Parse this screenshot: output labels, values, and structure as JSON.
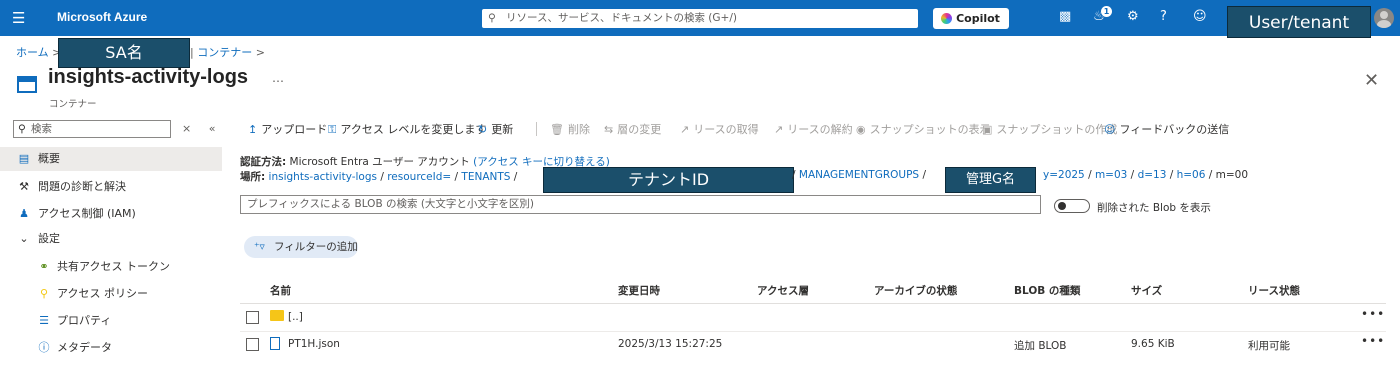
{
  "topbar": {
    "brand": "Microsoft Azure",
    "search_placeholder": "リソース、サービス、ドキュメントの検索 (G+/)",
    "copilot_label": "Copilot",
    "notification_count": "1",
    "redacted_user_label": "User/tenant"
  },
  "breadcrumb": {
    "home": "ホーム",
    "redacted_account": "SA名",
    "containers": "コンテナー"
  },
  "header": {
    "title": "insights-activity-logs",
    "subtitle": "コンテナー",
    "more": "…"
  },
  "sidebar": {
    "search_placeholder": "検索",
    "items": [
      {
        "label": "概要",
        "icon": "overview-icon"
      },
      {
        "label": "問題の診断と解決",
        "icon": "wrench-icon"
      },
      {
        "label": "アクセス制御 (IAM)",
        "icon": "people-icon"
      },
      {
        "label": "設定",
        "icon": "chevron-down-icon"
      },
      {
        "label": "共有アクセス トークン",
        "icon": "link-icon"
      },
      {
        "label": "アクセス ポリシー",
        "icon": "key-icon"
      },
      {
        "label": "プロパティ",
        "icon": "properties-icon"
      },
      {
        "label": "メタデータ",
        "icon": "info-icon"
      }
    ]
  },
  "toolbar": {
    "upload": "アップロード",
    "change_access": "アクセス レベルを変更します",
    "refresh": "更新",
    "delete": "削除",
    "change_tier": "層の変更",
    "acquire_lease": "リースの取得",
    "break_lease": "リースの解約",
    "view_snapshots": "スナップショットの表示",
    "create_snapshot": "スナップショットの作成",
    "feedback": "フィードバックの送信"
  },
  "info": {
    "auth_label": "認証方法:",
    "auth_value": "Microsoft Entra ユーザー アカウント",
    "auth_switch": "(アクセス キーに切り替える)",
    "location_label": "場所:",
    "path_1": "insights-activity-logs",
    "path_2": "resourceId=",
    "path_3": "TENANTS",
    "redacted_tenant": "テナントID",
    "path_4": "MANAGEMENTGROUPS",
    "redacted_mg": "管理G名",
    "path_5": "y=2025",
    "path_6": "m=03",
    "path_7": "d=13",
    "path_8": "h=06",
    "path_9": "m=00"
  },
  "filter": {
    "prefix_placeholder": "プレフィックスによる BLOB の検索 (大文字と小文字を区別)",
    "show_deleted": "削除された Blob を表示",
    "add_filter": "フィルターの追加"
  },
  "table": {
    "headers": [
      "名前",
      "変更日時",
      "アクセス層",
      "アーカイブの状態",
      "BLOB の種類",
      "サイズ",
      "リース状態"
    ],
    "rows": [
      {
        "name": "[..]",
        "modified": "",
        "tier": "",
        "archive": "",
        "type": "",
        "size": "",
        "lease": ""
      },
      {
        "name": "PT1H.json",
        "modified": "2025/3/13 15:27:25",
        "tier": "",
        "archive": "",
        "type": "追加 BLOB",
        "size": "9.65 KiB",
        "lease": "利用可能"
      }
    ],
    "more": "•••"
  },
  "colors": {
    "accent": "#0f6cbd",
    "redaction": "#1b4f6b"
  }
}
